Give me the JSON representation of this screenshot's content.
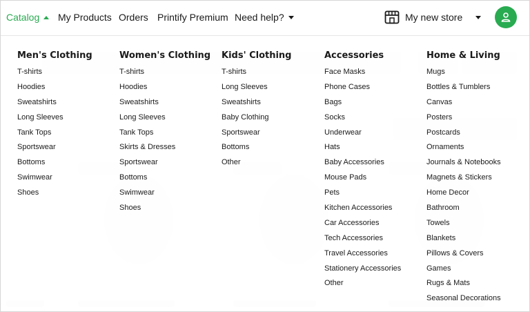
{
  "nav": {
    "catalog": "Catalog",
    "my_products": "My Products",
    "orders": "Orders",
    "premium": "Printify Premium",
    "help": "Need help?",
    "store": "My new store"
  },
  "colors": {
    "accent": "#29ab51"
  },
  "icons": {
    "store": "store-icon",
    "avatar": "user-icon"
  },
  "menu": [
    {
      "title": "Men's Clothing",
      "items": [
        "T-shirts",
        "Hoodies",
        "Sweatshirts",
        "Long Sleeves",
        "Tank Tops",
        "Sportswear",
        "Bottoms",
        "Swimwear",
        "Shoes"
      ]
    },
    {
      "title": "Women's Clothing",
      "items": [
        "T-shirts",
        "Hoodies",
        "Sweatshirts",
        "Long Sleeves",
        "Tank Tops",
        "Skirts & Dresses",
        "Sportswear",
        "Bottoms",
        "Swimwear",
        "Shoes"
      ]
    },
    {
      "title": "Kids' Clothing",
      "items": [
        "T-shirts",
        "Long Sleeves",
        "Sweatshirts",
        "Baby Clothing",
        "Sportswear",
        "Bottoms",
        "Other"
      ]
    },
    {
      "title": "Accessories",
      "items": [
        "Face Masks",
        "Phone Cases",
        "Bags",
        "Socks",
        "Underwear",
        "Hats",
        "Baby Accessories",
        "Mouse Pads",
        "Pets",
        "Kitchen Accessories",
        "Car Accessories",
        "Tech Accessories",
        "Travel Accessories",
        "Stationery Accessories",
        "Other"
      ]
    },
    {
      "title": "Home & Living",
      "items": [
        "Mugs",
        "Bottles & Tumblers",
        "Canvas",
        "Posters",
        "Postcards",
        "Ornaments",
        "Journals & Notebooks",
        "Magnets & Stickers",
        "Home Decor",
        "Bathroom",
        "Towels",
        "Blankets",
        "Pillows & Covers",
        "Games",
        "Rugs & Mats",
        "Seasonal Decorations"
      ]
    }
  ]
}
